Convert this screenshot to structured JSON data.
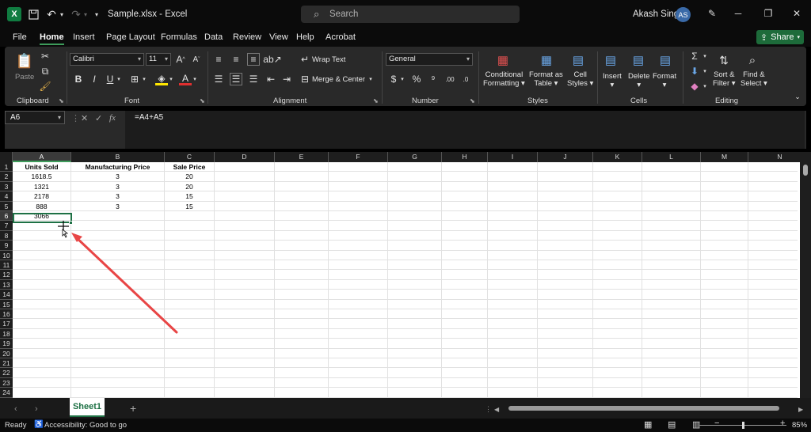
{
  "window": {
    "title": "Sample.xlsx  -  Excel",
    "logo": "X",
    "search_placeholder": "Search",
    "user_name": "Akash Singh",
    "user_initials": "AS"
  },
  "menu": {
    "tabs": [
      "File",
      "Home",
      "Insert",
      "Page Layout",
      "Formulas",
      "Data",
      "Review",
      "View",
      "Help",
      "Acrobat"
    ],
    "active": "Home",
    "share_label": "Share"
  },
  "ribbon": {
    "clipboard": {
      "label": "Clipboard",
      "paste": "Paste"
    },
    "font": {
      "label": "Font",
      "name": "Calibri",
      "size": "11"
    },
    "alignment": {
      "label": "Alignment",
      "wrap": "Wrap Text",
      "merge": "Merge & Center"
    },
    "number": {
      "label": "Number",
      "format": "General"
    },
    "styles": {
      "label": "Styles",
      "conditional": [
        "Conditional",
        "Formatting"
      ],
      "format_table": [
        "Format as",
        "Table"
      ],
      "cell_styles": [
        "Cell",
        "Styles"
      ]
    },
    "cells": {
      "label": "Cells",
      "insert": "Insert",
      "delete": "Delete",
      "format": "Format"
    },
    "editing": {
      "label": "Editing",
      "sort": [
        "Sort &",
        "Filter"
      ],
      "find": [
        "Find &",
        "Select"
      ]
    }
  },
  "formula_bar": {
    "name_box": "A6",
    "formula": "=A4+A5"
  },
  "sheet": {
    "columns": [
      "A",
      "B",
      "C",
      "D",
      "E",
      "F",
      "G",
      "H",
      "I",
      "J",
      "K",
      "L",
      "M",
      "N"
    ],
    "rows": [
      "1",
      "2",
      "3",
      "4",
      "5",
      "6",
      "7",
      "8",
      "9",
      "10",
      "11",
      "12",
      "13",
      "14",
      "15",
      "16",
      "17",
      "18",
      "19",
      "20",
      "21",
      "22",
      "23",
      "24"
    ],
    "cells": [
      [
        "Units Sold",
        "Manufacturing Price",
        "Sale Price"
      ],
      [
        "1618.5",
        "3",
        "20"
      ],
      [
        "1321",
        "3",
        "20"
      ],
      [
        "2178",
        "3",
        "15"
      ],
      [
        "888",
        "3",
        "15"
      ],
      [
        "3066",
        "",
        ""
      ]
    ]
  },
  "tabs": {
    "sheet_name": "Sheet1",
    "add": "+"
  },
  "status": {
    "ready": "Ready",
    "accessibility": "Accessibility: Good to go",
    "zoom_minus": "−",
    "zoom_plus": "+",
    "zoom": "85%"
  }
}
